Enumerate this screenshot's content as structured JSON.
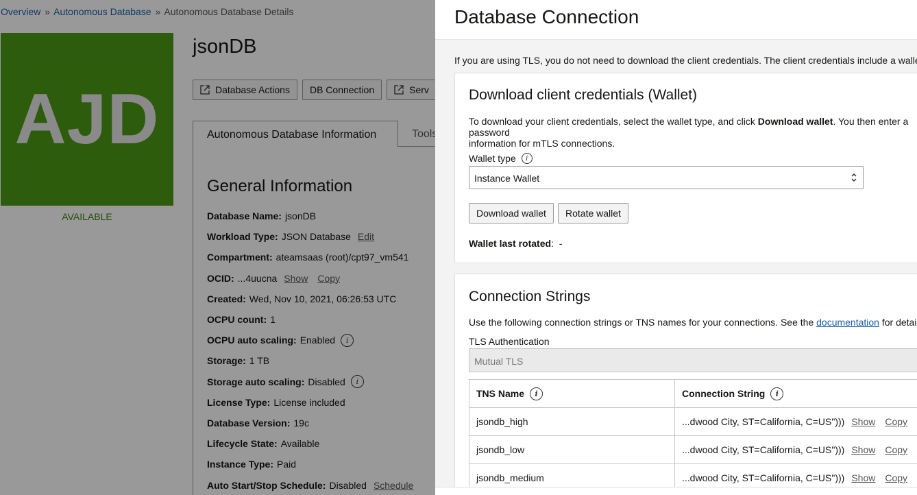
{
  "breadcrumb": {
    "items": [
      "Overview",
      "Autonomous Database"
    ],
    "separator": "»",
    "current": "Autonomous Database Details"
  },
  "database": {
    "logo_text": "AJD",
    "logo_color": "#4b9a16",
    "status": "AVAILABLE",
    "name": "jsonDB"
  },
  "actions": {
    "database_actions": "Database Actions",
    "db_connection": "DB Connection",
    "service_console_partial": "Serv"
  },
  "tabs": {
    "active": "Autonomous Database Information",
    "other_partial": "Tools"
  },
  "general_info": {
    "title": "General Information",
    "rows": [
      {
        "key": "Database Name:",
        "value": "jsonDB"
      },
      {
        "key": "Workload Type:",
        "value": "JSON Database",
        "link": "Edit"
      },
      {
        "key": "Compartment:",
        "value": "ateamsaas (root)/cpt97_vm541"
      },
      {
        "key": "OCID:",
        "value": "...4uucna",
        "link": "Show",
        "link2": "Copy"
      },
      {
        "key": "Created:",
        "value": "Wed, Nov 10, 2021, 06:26:53 UTC"
      },
      {
        "key": "OCPU count:",
        "value": "1"
      },
      {
        "key": "OCPU auto scaling:",
        "value": "Enabled",
        "info": true
      },
      {
        "key": "Storage:",
        "value": "1 TB"
      },
      {
        "key": "Storage auto scaling:",
        "value": "Disabled",
        "info": true
      },
      {
        "key": "License Type:",
        "value": "License included"
      },
      {
        "key": "Database Version:",
        "value": "19c"
      },
      {
        "key": "Lifecycle State:",
        "value": "Available"
      },
      {
        "key": "Instance Type:",
        "value": "Paid"
      },
      {
        "key": "Auto Start/Stop Schedule:",
        "value": "Disabled",
        "link": "Schedule"
      }
    ]
  },
  "drawer": {
    "title": "Database Connection",
    "intro": "If you are using TLS, you do not need to download the client credentials. The client credentials include a wallet",
    "wallet": {
      "title": "Download client credentials (Wallet)",
      "desc_before": "To download your client credentials, select the wallet type, and click ",
      "desc_bold": "Download wallet",
      "desc_after": ". You then enter a password",
      "desc_line2": "information for mTLS connections.",
      "type_label": "Wallet type",
      "type_value": "Instance Wallet",
      "download_button": "Download wallet",
      "rotate_button": "Rotate wallet",
      "last_rotated_label": "Wallet last rotated",
      "last_rotated_value": "-"
    },
    "connection": {
      "title": "Connection Strings",
      "desc_before": "Use the following connection strings or TNS names for your connections. See the ",
      "desc_link": "documentation",
      "desc_after": " for details.",
      "tls_label": "TLS Authentication",
      "tls_value": "Mutual TLS",
      "columns": [
        "TNS Name",
        "Connection String"
      ],
      "rows": [
        {
          "name": "jsondb_high",
          "conn": "...dwood City, ST=California, C=US\")))",
          "show": "Show",
          "copy": "Copy"
        },
        {
          "name": "jsondb_low",
          "conn": "...dwood City, ST=California, C=US\")))",
          "show": "Show",
          "copy": "Copy"
        },
        {
          "name": "jsondb_medium",
          "conn": "...dwood City, ST=California, C=US\")))",
          "show": "Show",
          "copy": "Copy"
        }
      ]
    }
  }
}
